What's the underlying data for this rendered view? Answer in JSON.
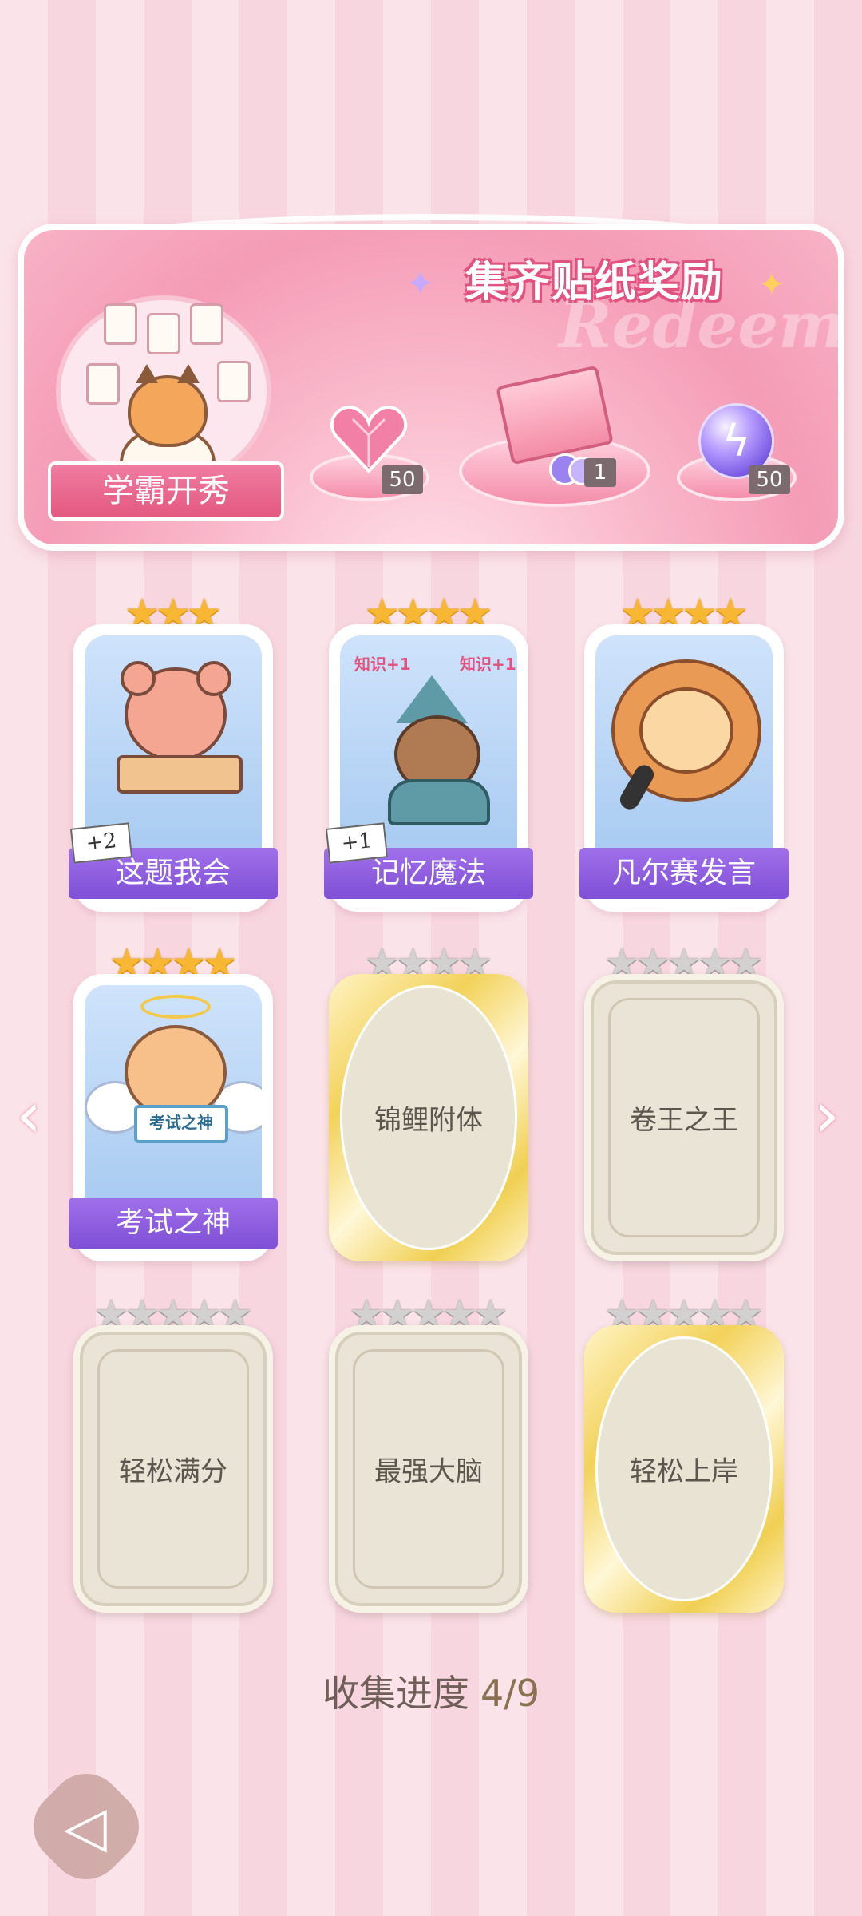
{
  "banner": {
    "title": "集齐贴纸奖励",
    "watermark": "Redeem",
    "ribbon_label": "学霸开秀",
    "rewards": [
      {
        "icon": "pink-heart-gem-icon",
        "qty": "50"
      },
      {
        "icon": "gift-box-icon",
        "qty": "1"
      },
      {
        "icon": "purple-lightning-orb-icon",
        "qty": "50"
      }
    ]
  },
  "cards": [
    {
      "name": "这题我会",
      "stars": 3,
      "state": "earned",
      "bonus": "+2"
    },
    {
      "name": "记忆魔法",
      "stars": 4,
      "state": "earned",
      "bonus": "+1"
    },
    {
      "name": "凡尔赛发言",
      "stars": 4,
      "state": "earned",
      "bonus": ""
    },
    {
      "name": "考试之神",
      "stars": 4,
      "state": "earned",
      "bonus": "",
      "sign": "考试之神"
    },
    {
      "name": "锦鲤附体",
      "stars": 4,
      "state": "locked-gold"
    },
    {
      "name": "卷王之王",
      "stars": 5,
      "state": "locked-silver"
    },
    {
      "name": "轻松满分",
      "stars": 5,
      "state": "locked-silver"
    },
    {
      "name": "最强大脑",
      "stars": 5,
      "state": "locked-silver"
    },
    {
      "name": "轻松上岸",
      "stars": 5,
      "state": "locked-gold"
    }
  ],
  "wizard_sign": "知识+1",
  "progress": {
    "label": "收集进度",
    "value": "4/9"
  },
  "colors": {
    "accent_pink": "#e3587f",
    "label_purple": "#8a5adf",
    "star_gold": "#f7b733",
    "star_silver": "#d2d0d0"
  }
}
